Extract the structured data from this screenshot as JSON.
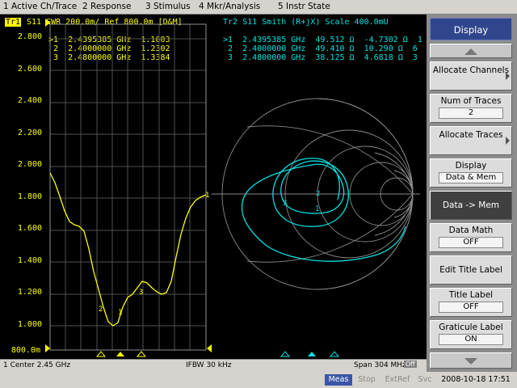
{
  "menu": [
    "1 Active Ch/Trace",
    "2 Response",
    "3 Stimulus",
    "4 Mkr/Analysis",
    "5 Instr State"
  ],
  "tr1": {
    "tag": "Tr1",
    "label": "S11  SWR 200.0m/ Ref 800.0m [D&M]",
    "color": "#ffff00"
  },
  "tr2": {
    "label": "Tr2  S11  Smith (R+jX)  Scale 400.0mU",
    "color": "#00e0e0"
  },
  "tr1_markers": [
    ">1  2.4395385 GHz  1.1003",
    " 2  2.4000000 GHz  1.2302",
    " 3  2.4800000 GHz  1.3384"
  ],
  "tr2_markers": [
    ">1  2.4395385 GHz  49.512 Ω  -4.7302 Ω  1",
    " 2  2.4000000 GHz  49.410 Ω  10.290 Ω  6",
    " 3  2.4800000 GHz  38.125 Ω  4.6818 Ω  3"
  ],
  "y_ticks": [
    "2.800",
    "2.600",
    "2.400",
    "2.200",
    "2.000",
    "1.800",
    "1.600",
    "1.400",
    "1.200",
    "1.000",
    "800.0m"
  ],
  "swr_trace": {
    "description_values": [
      2.0,
      1.68,
      1.65,
      1.25,
      1.05,
      1.28,
      1.33,
      1.26,
      1.55,
      1.88
    ],
    "marker_labels": [
      "1",
      "2",
      "3"
    ]
  },
  "status": {
    "channel": "1  Center 2.45 GHz",
    "ifbw": "IFBW 30 kHz",
    "span": "Span 304 MHz",
    "off": "Off"
  },
  "bottom": {
    "meas": "Meas",
    "stop": "Stop",
    "extref": "ExtRef",
    "svc": "Svc",
    "datetime": "2008-10-18 17:51"
  },
  "softkeys": {
    "title": "Display",
    "allocate_channels": "Allocate Channels",
    "num_traces": "Num of Traces",
    "num_traces_val": "2",
    "allocate_traces": "Allocate Traces",
    "display": "Display",
    "display_val": "Data & Mem",
    "data_mem": "Data -> Mem",
    "data_math": "Data Math",
    "data_math_val": "OFF",
    "edit_title": "Edit Title Label",
    "title_label": "Title Label",
    "title_label_val": "OFF",
    "graticule_label": "Graticule Label",
    "graticule_label_val": "ON"
  }
}
